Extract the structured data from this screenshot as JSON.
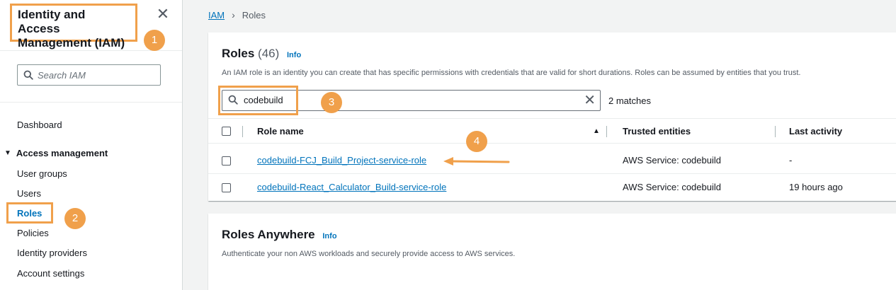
{
  "sidebar": {
    "title": "Identity and Access Management (IAM)",
    "search_placeholder": "Search IAM",
    "dashboard": "Dashboard",
    "section_label": "Access management",
    "items": [
      "User groups",
      "Users",
      "Roles",
      "Policies",
      "Identity providers",
      "Account settings"
    ]
  },
  "breadcrumb": {
    "root": "IAM",
    "current": "Roles"
  },
  "roles_card": {
    "title": "Roles",
    "count": "(46)",
    "info": "Info",
    "description": "An IAM role is an identity you can create that has specific permissions with credentials that are valid for short durations. Roles can be assumed by entities that you trust.",
    "filter_value": "codebuild",
    "matches": "2 matches",
    "columns": [
      "Role name",
      "Trusted entities",
      "Last activity"
    ],
    "rows": [
      {
        "name": "codebuild-FCJ_Build_Project-service-role",
        "trusted": "AWS Service: codebuild",
        "last_activity": "-"
      },
      {
        "name": "codebuild-React_Calculator_Build-service-role",
        "trusted": "AWS Service: codebuild",
        "last_activity": "19 hours ago"
      }
    ]
  },
  "anywhere_card": {
    "title": "Roles Anywhere",
    "info": "Info",
    "description": "Authenticate your non AWS workloads and securely provide access to AWS services."
  },
  "markers": [
    "1",
    "2",
    "3",
    "4"
  ],
  "colors": {
    "accent": "#f0a04b",
    "link": "#0073bb",
    "text": "#16191f"
  },
  "icons": [
    "close-icon",
    "search-icon",
    "caret-down-icon",
    "sort-ascending-icon",
    "clear-icon",
    "annotation-arrow-icon"
  ]
}
